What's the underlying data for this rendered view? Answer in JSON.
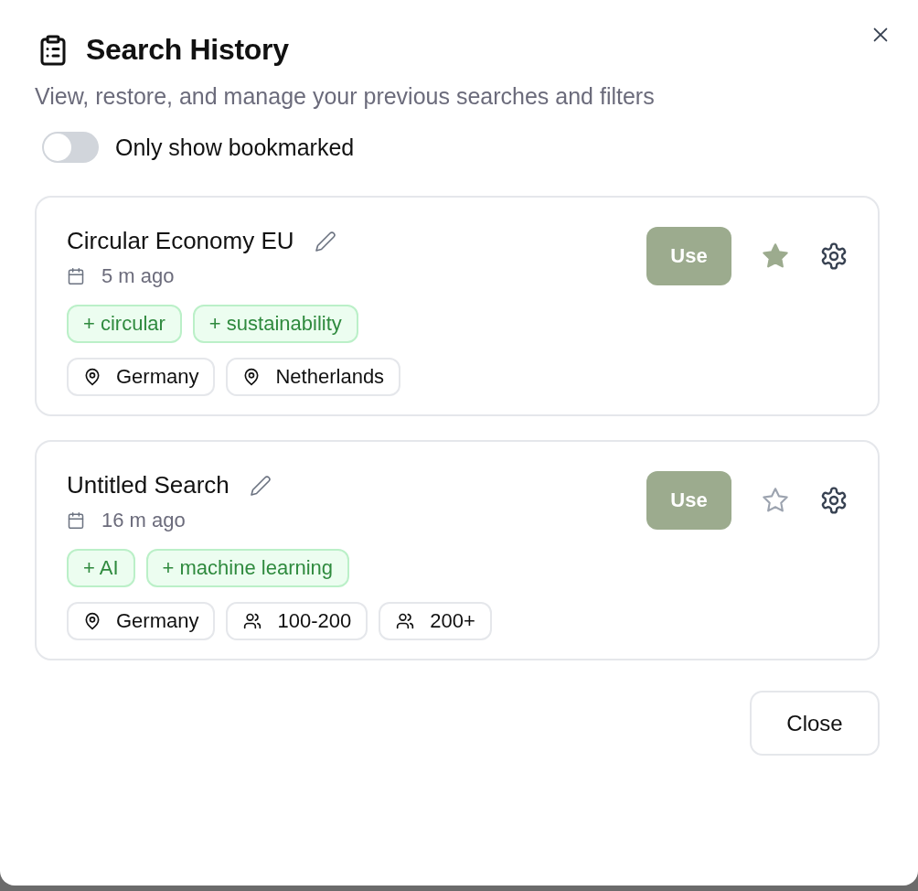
{
  "dialog": {
    "title": "Search History",
    "description": "View, restore, and manage your previous searches and filters",
    "close_label": "Close"
  },
  "bookmark_filter": {
    "label": "Only show bookmarked",
    "on": false
  },
  "searches": [
    {
      "name": "Circular Economy EU",
      "time": "5 m ago",
      "bookmarked": true,
      "use_label": "Use",
      "keywords": [
        "+ circular",
        "+ sustainability"
      ],
      "filters": [
        {
          "kind": "location",
          "label": "Germany"
        },
        {
          "kind": "location",
          "label": "Netherlands"
        }
      ]
    },
    {
      "name": "Untitled Search",
      "time": "16 m ago",
      "bookmarked": false,
      "use_label": "Use",
      "keywords": [
        "+ AI",
        "+ machine learning"
      ],
      "filters": [
        {
          "kind": "location",
          "label": "Germany"
        },
        {
          "kind": "employees",
          "label": "100-200"
        },
        {
          "kind": "employees",
          "label": "200+"
        }
      ]
    }
  ]
}
